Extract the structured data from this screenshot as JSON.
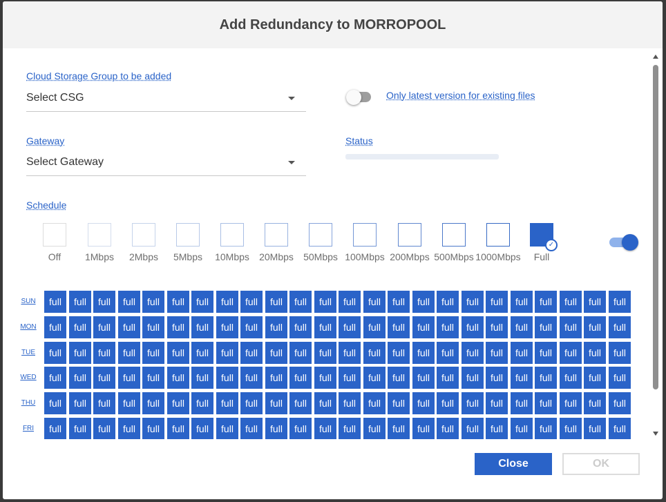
{
  "dialog": {
    "title": "Add Redundancy to MORROPOOL"
  },
  "csg": {
    "label": "Cloud Storage Group to be added",
    "value": "Select CSG"
  },
  "latest_version": {
    "label": "Only latest version for existing files",
    "enabled": false
  },
  "gateway": {
    "label": "Gateway",
    "value": "Select Gateway"
  },
  "status": {
    "label": "Status",
    "progress": 0
  },
  "schedule": {
    "label": "Schedule",
    "enabled": true,
    "selected_speed": "Full",
    "speeds": [
      "Off",
      "1Mbps",
      "2Mbps",
      "5Mbps",
      "10Mbps",
      "20Mbps",
      "50Mbps",
      "100Mbps",
      "200Mbps",
      "500Mbps",
      "1000Mbps",
      "Full"
    ],
    "days": [
      {
        "label": "SUN",
        "hours": [
          "full",
          "full",
          "full",
          "full",
          "full",
          "full",
          "full",
          "full",
          "full",
          "full",
          "full",
          "full",
          "full",
          "full",
          "full",
          "full",
          "full",
          "full",
          "full",
          "full",
          "full",
          "full",
          "full",
          "full"
        ]
      },
      {
        "label": "MON",
        "hours": [
          "full",
          "full",
          "full",
          "full",
          "full",
          "full",
          "full",
          "full",
          "full",
          "full",
          "full",
          "full",
          "full",
          "full",
          "full",
          "full",
          "full",
          "full",
          "full",
          "full",
          "full",
          "full",
          "full",
          "full"
        ]
      },
      {
        "label": "TUE",
        "hours": [
          "full",
          "full",
          "full",
          "full",
          "full",
          "full",
          "full",
          "full",
          "full",
          "full",
          "full",
          "full",
          "full",
          "full",
          "full",
          "full",
          "full",
          "full",
          "full",
          "full",
          "full",
          "full",
          "full",
          "full"
        ]
      },
      {
        "label": "WED",
        "hours": [
          "full",
          "full",
          "full",
          "full",
          "full",
          "full",
          "full",
          "full",
          "full",
          "full",
          "full",
          "full",
          "full",
          "full",
          "full",
          "full",
          "full",
          "full",
          "full",
          "full",
          "full",
          "full",
          "full",
          "full"
        ]
      },
      {
        "label": "THU",
        "hours": [
          "full",
          "full",
          "full",
          "full",
          "full",
          "full",
          "full",
          "full",
          "full",
          "full",
          "full",
          "full",
          "full",
          "full",
          "full",
          "full",
          "full",
          "full",
          "full",
          "full",
          "full",
          "full",
          "full",
          "full"
        ]
      },
      {
        "label": "FRI",
        "hours": [
          "full",
          "full",
          "full",
          "full",
          "full",
          "full",
          "full",
          "full",
          "full",
          "full",
          "full",
          "full",
          "full",
          "full",
          "full",
          "full",
          "full",
          "full",
          "full",
          "full",
          "full",
          "full",
          "full",
          "full"
        ]
      }
    ]
  },
  "footer": {
    "close_label": "Close",
    "ok_label": "OK"
  },
  "colors": {
    "accent": "#2a63c8"
  }
}
